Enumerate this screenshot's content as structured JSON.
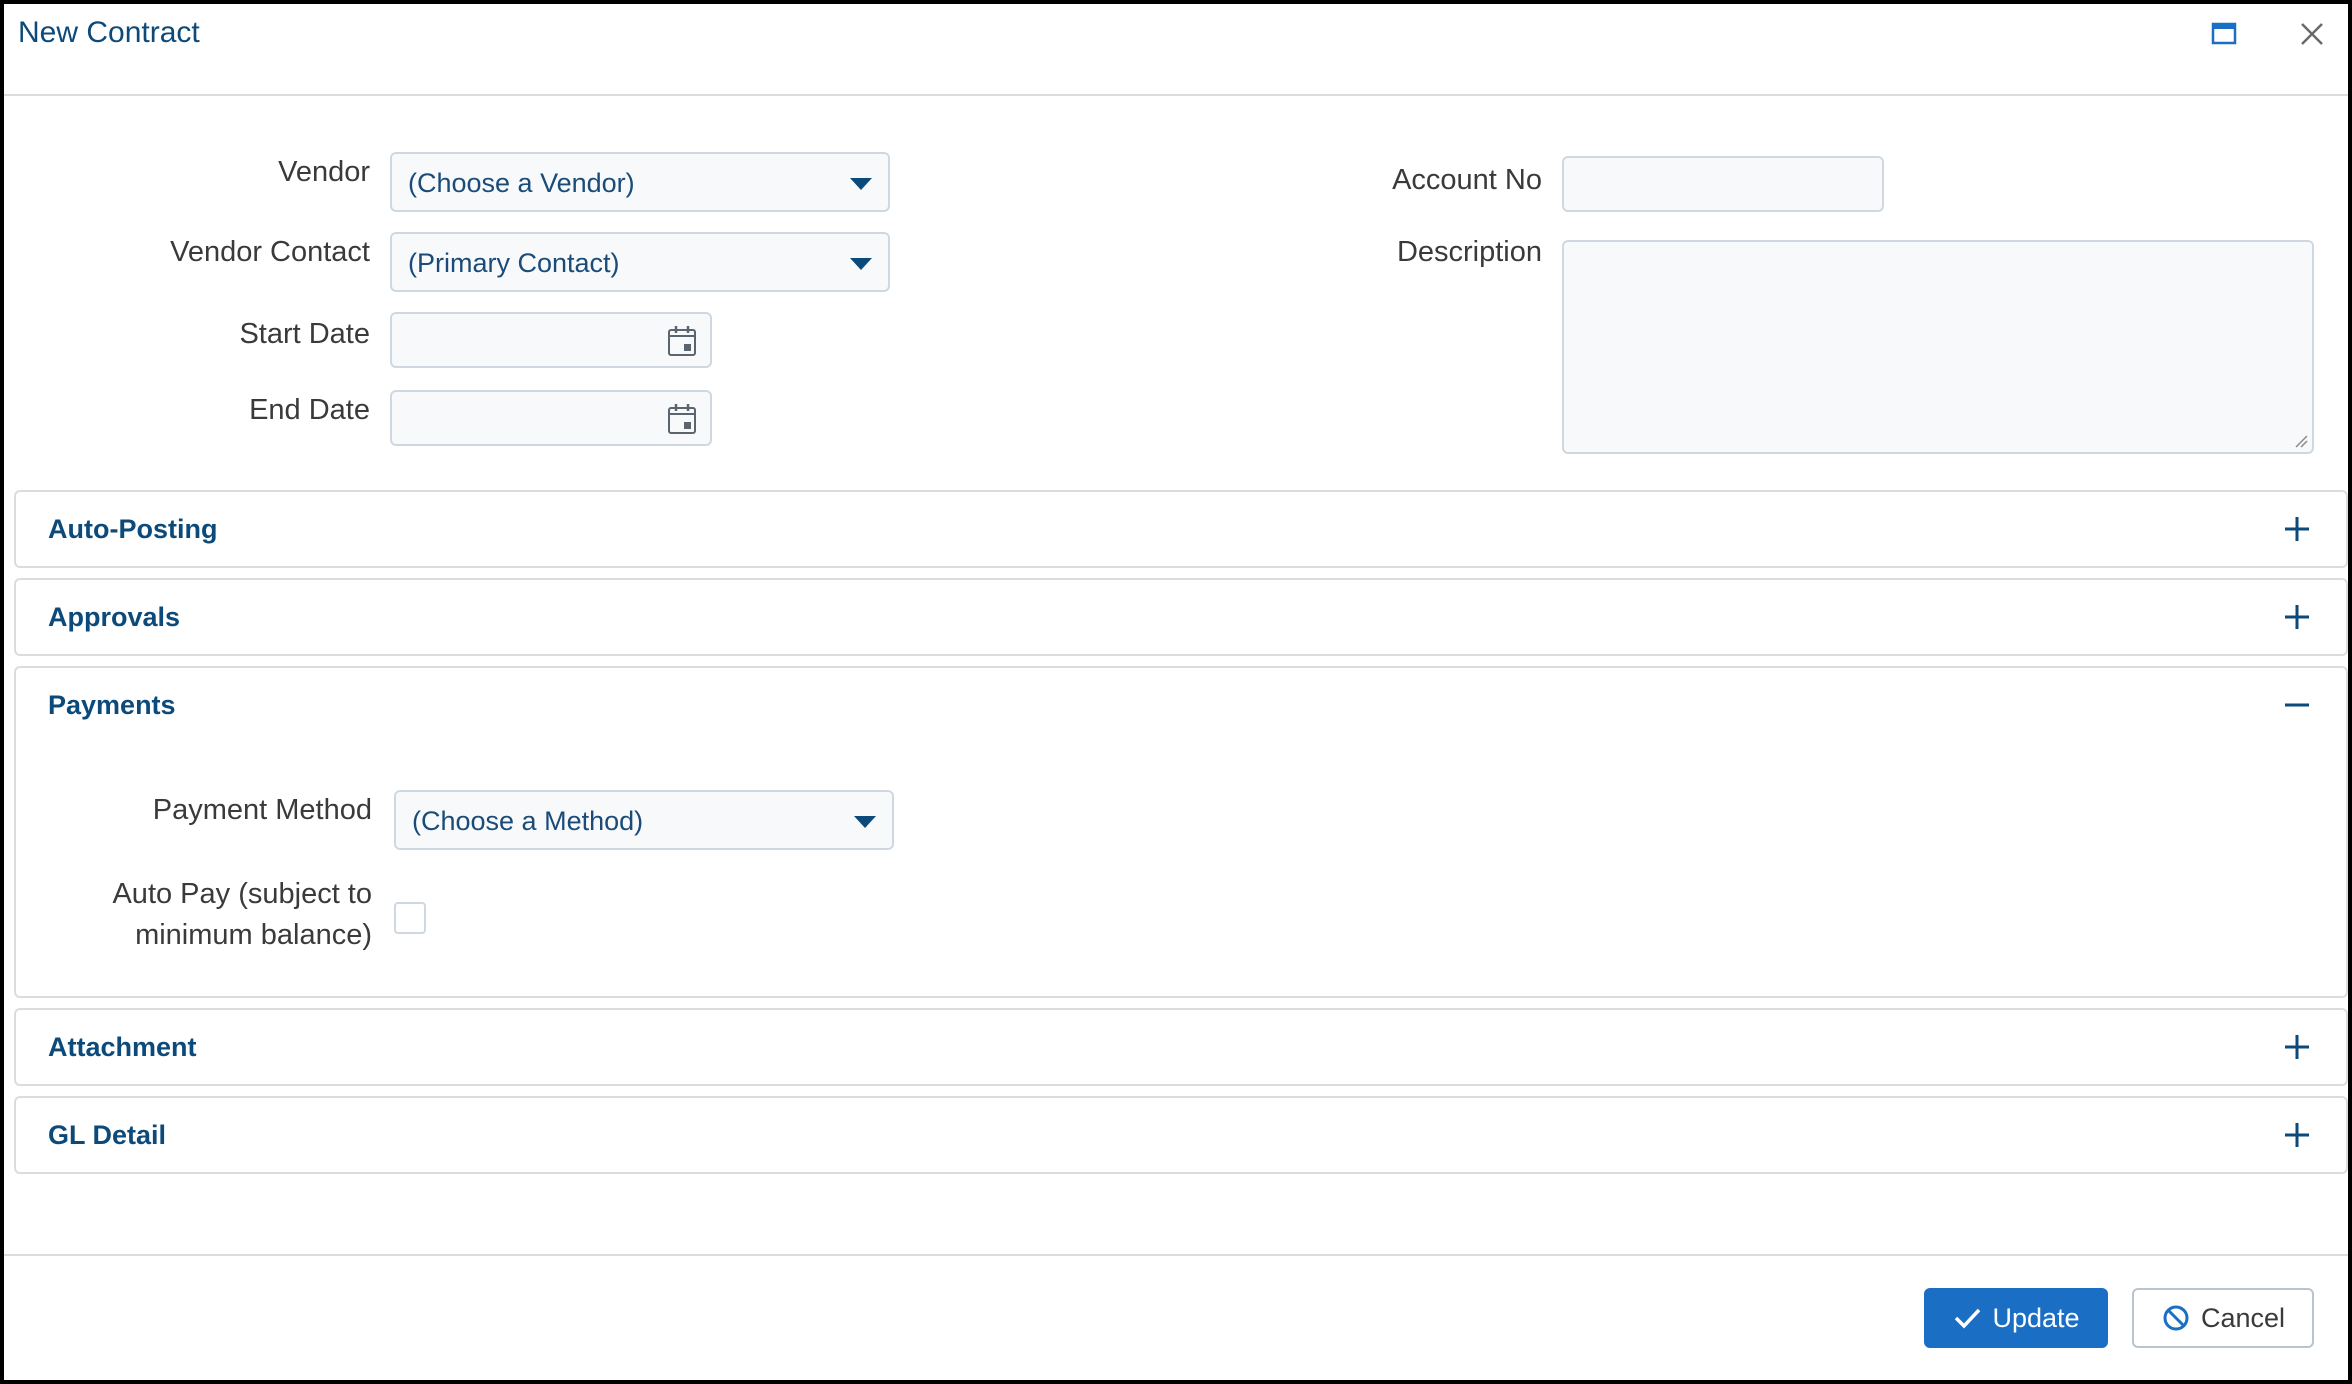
{
  "window": {
    "title": "New Contract"
  },
  "form": {
    "vendor": {
      "label": "Vendor",
      "value": "(Choose a Vendor)"
    },
    "vendor_contact": {
      "label": "Vendor Contact",
      "value": "(Primary Contact)"
    },
    "start_date": {
      "label": "Start Date",
      "value": ""
    },
    "end_date": {
      "label": "End Date",
      "value": ""
    },
    "account_no": {
      "label": "Account No",
      "value": ""
    },
    "description": {
      "label": "Description",
      "value": ""
    }
  },
  "sections": [
    {
      "title": "Auto-Posting",
      "expanded": false
    },
    {
      "title": "Approvals",
      "expanded": false
    },
    {
      "title": "Payments",
      "expanded": true
    },
    {
      "title": "Attachment",
      "expanded": false
    },
    {
      "title": "GL Detail",
      "expanded": false
    }
  ],
  "payments": {
    "payment_method": {
      "label": "Payment Method",
      "value": "(Choose a Method)"
    },
    "auto_pay": {
      "label_line1": "Auto Pay (subject to",
      "label_line2": "minimum balance)",
      "checked": false
    }
  },
  "footer": {
    "update_label": "Update",
    "cancel_label": "Cancel"
  },
  "colors": {
    "accent": "#1a6fc5",
    "heading": "#0b4a7a"
  }
}
